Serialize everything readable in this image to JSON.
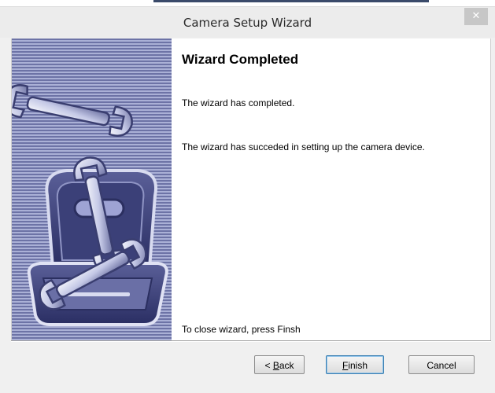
{
  "window": {
    "title": "Camera Setup Wizard",
    "close_glyph": "✕"
  },
  "wizard": {
    "heading": "Wizard Completed",
    "line1": "The wizard has completed.",
    "line2": "The wizard has succeded in setting up the camera device.",
    "closing_hint": "To close wizard, press Finsh"
  },
  "buttons": {
    "back_prefix": "< ",
    "back_mnemonic": "B",
    "back_rest": "ack",
    "finish_mnemonic": "F",
    "finish_rest": "inish",
    "cancel": "Cancel"
  },
  "illustration": {
    "name": "toolbox-with-wrenches",
    "stripe_colors": [
      "#6d73a6",
      "#aab0d6"
    ]
  }
}
